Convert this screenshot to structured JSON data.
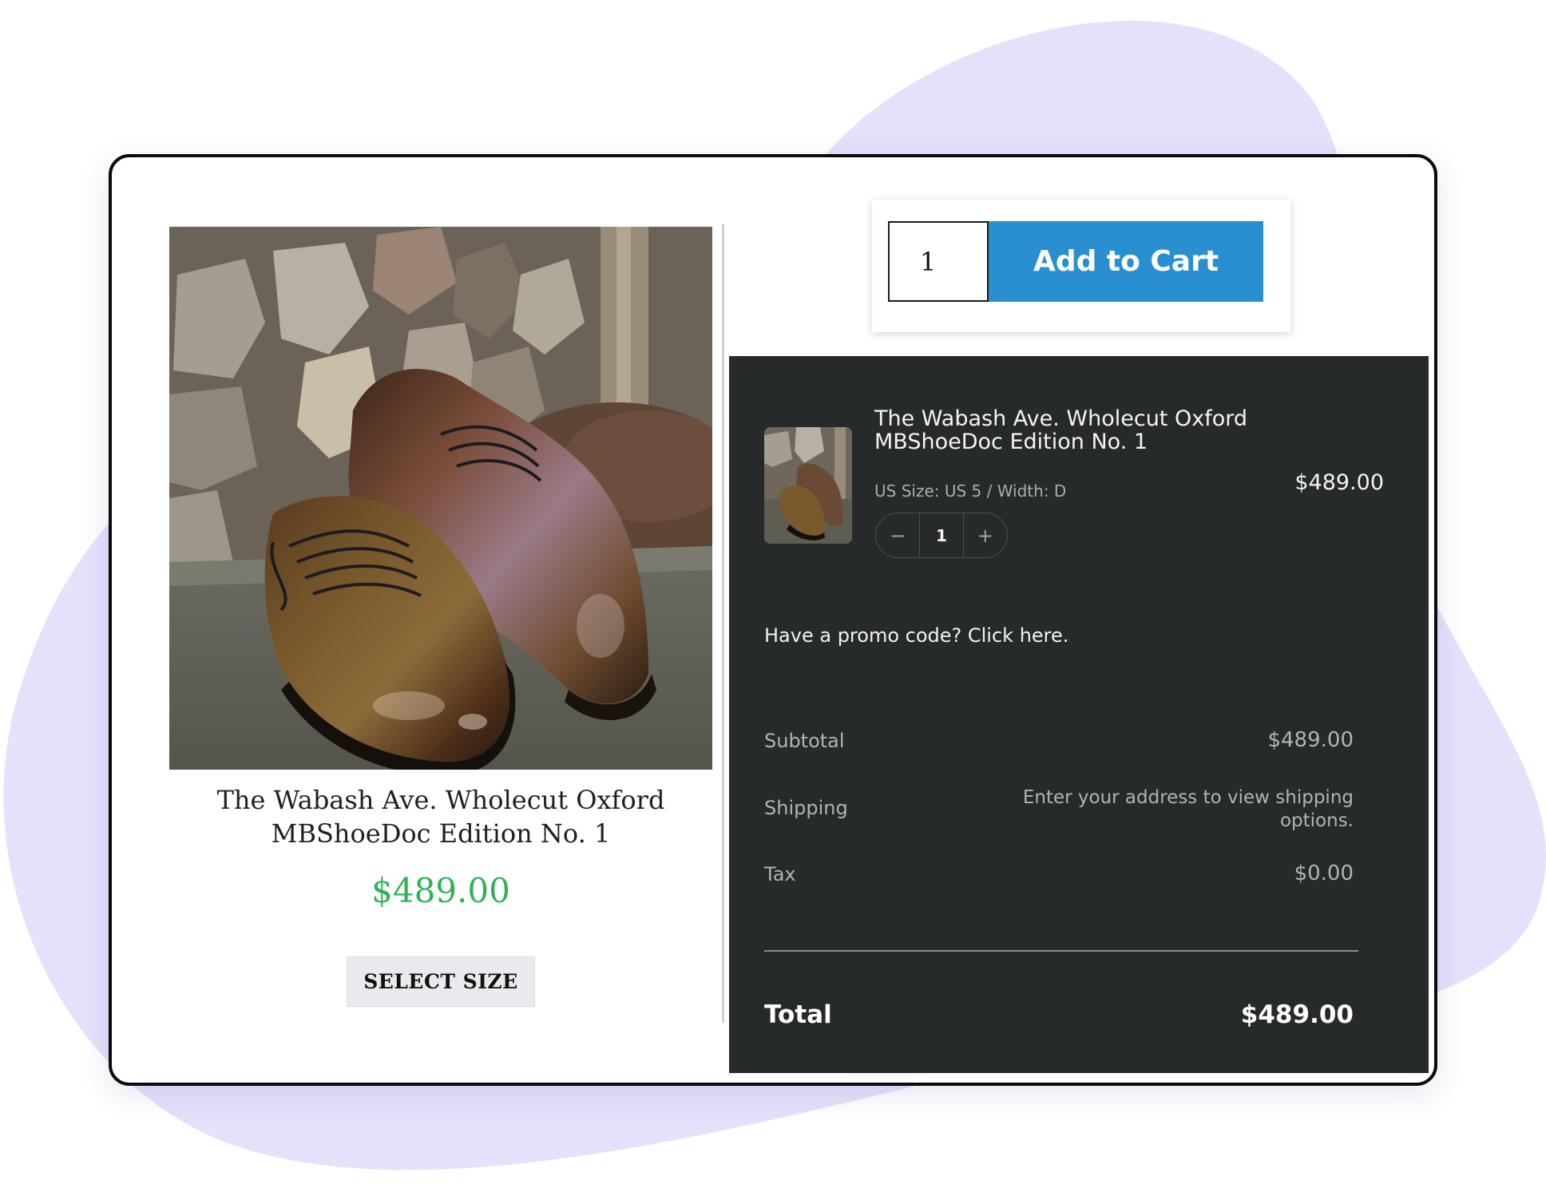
{
  "colors": {
    "blob": "#e6e1fb",
    "accent_button": "#2a8fd0",
    "price_green": "#2fb257",
    "cart_panel": "#262a2b"
  },
  "product": {
    "image_icon": "product-photo",
    "title": "The Wabash Ave. Wholecut Oxford MBShoeDoc Edition No. 1",
    "price": "$489.00",
    "select_size_label": "SELECT SIZE"
  },
  "add_to_cart": {
    "quantity": "1",
    "button_label": "Add to Cart"
  },
  "cart": {
    "item": {
      "title": "The Wabash Ave. Wholecut Oxford MBShoeDoc Edition No. 1",
      "variant": "US Size: US 5 / Width: D",
      "price": "$489.00",
      "quantity": "1",
      "decrement_glyph": "−",
      "increment_glyph": "+"
    },
    "promo_text": "Have a promo code? Click here.",
    "summary": {
      "subtotal_label": "Subtotal",
      "subtotal_value": "$489.00",
      "shipping_label": "Shipping",
      "shipping_value": "Enter your address to view shipping options.",
      "tax_label": "Tax",
      "tax_value": "$0.00"
    },
    "total_label": "Total",
    "total_value": "$489.00"
  }
}
